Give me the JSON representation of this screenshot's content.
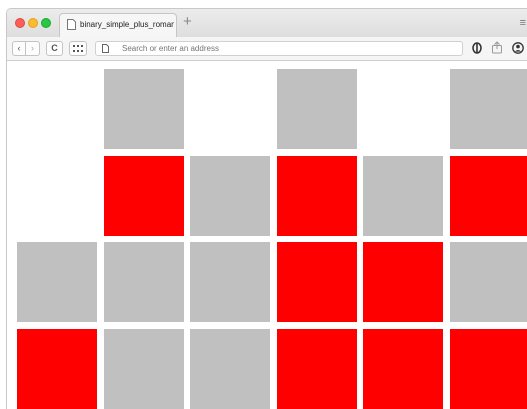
{
  "browser": {
    "tab_title": "binary_simple_plus_roman.html",
    "new_tab_label": "+",
    "address_placeholder": "Search or enter an address",
    "back_label": "‹",
    "forward_label": "›",
    "reload_label": "C",
    "menu_label": "≡"
  },
  "colors": {
    "on": "#ff0000",
    "off": "#c0c0c0"
  },
  "grid": {
    "rows": [
      [
        "empty",
        "off",
        "empty",
        "off",
        "empty",
        "off"
      ],
      [
        "empty",
        "on",
        "off",
        "on",
        "off",
        "on"
      ],
      [
        "off",
        "off",
        "off",
        "on",
        "on",
        "off"
      ],
      [
        "on",
        "off",
        "off",
        "on",
        "on",
        "on"
      ]
    ]
  }
}
